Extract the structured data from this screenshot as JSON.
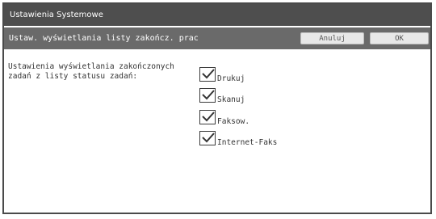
{
  "window": {
    "title": "Ustawienia Systemowe"
  },
  "subheader": {
    "title": "Ustaw. wyświetlania listy zakończ. prac",
    "cancel_label": "Anuluj",
    "ok_label": "OK"
  },
  "setting": {
    "label": "Ustawienia wyświetlania  zakończonych\nzadań z listy statusu zadań:"
  },
  "options": [
    {
      "label": "Drukuj",
      "checked": true
    },
    {
      "label": "Skanuj",
      "checked": true
    },
    {
      "label": "Faksow.",
      "checked": true
    },
    {
      "label": "Internet-Faks",
      "checked": true
    }
  ]
}
